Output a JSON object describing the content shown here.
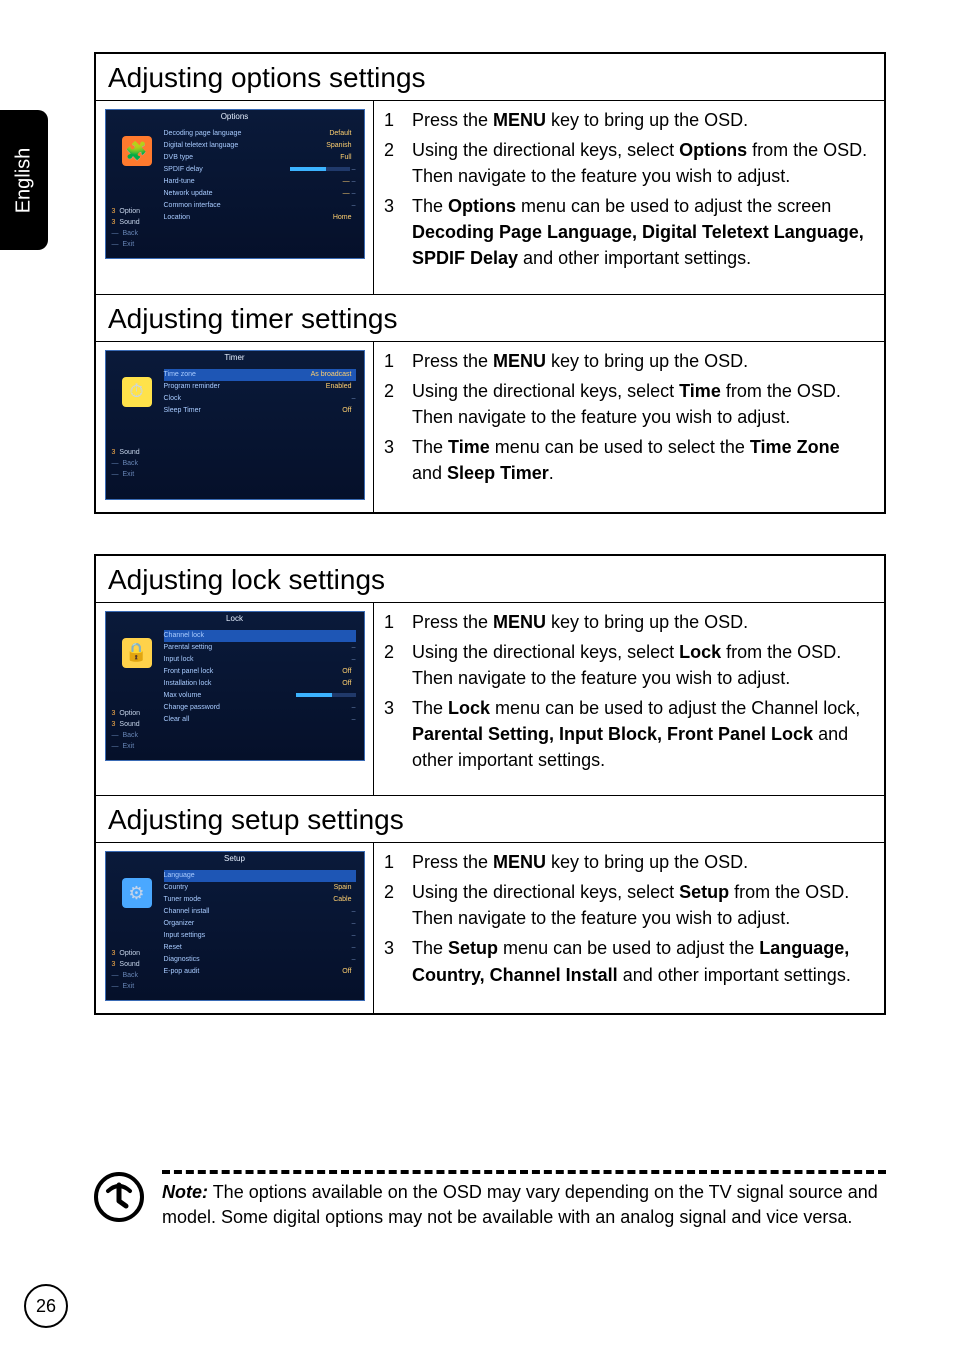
{
  "side_tab": {
    "label": "English"
  },
  "page_number": "26",
  "boxes": [
    {
      "sections": [
        {
          "title": "Adjusting options settings",
          "thumb": {
            "title_text": "Options",
            "icon_bg": "#ff7a2e",
            "icon_glyph": "🧩",
            "rows": [
              {
                "label": "Decoding page language",
                "value": "Default",
                "arrow": true
              },
              {
                "label": "Digital teletext language",
                "value": "Spanish",
                "arrow": true
              },
              {
                "label": "DVB type",
                "value": "Full",
                "arrow": true
              },
              {
                "label": "SPDIF delay",
                "value_bar": true,
                "dash": true
              },
              {
                "label": "Hard-tune",
                "value": "—",
                "dash": true
              },
              {
                "label": "Network update",
                "value": "—",
                "dash": true
              },
              {
                "label": "Common interface",
                "value": "",
                "dash": true
              },
              {
                "label": "Location",
                "value": "Home",
                "arrow": true
              }
            ],
            "left_menu": [
              {
                "num": "3",
                "label": "Option"
              },
              {
                "num": "3",
                "label": "Sound"
              },
              {
                "num": "—",
                "label": "Back",
                "dim": true
              },
              {
                "num": "—",
                "label": "Exit",
                "dim": true
              }
            ]
          },
          "steps": [
            {
              "num": "1",
              "parts": [
                "Press the ",
                {
                  "b": "MENU"
                },
                " key to bring up the OSD."
              ]
            },
            {
              "num": "2",
              "parts": [
                "Using the directional keys, select ",
                {
                  "b": "Options"
                },
                " from the OSD. Then navigate to the feature you wish to adjust."
              ]
            },
            {
              "num": "3",
              "parts": [
                "The ",
                {
                  "b": "Options"
                },
                " menu can be used to adjust the screen ",
                {
                  "b": "Decoding Page Language, Digital Teletext Language, SPDIF Delay"
                },
                " and other important settings."
              ]
            }
          ]
        },
        {
          "title": "Adjusting timer settings",
          "thumb": {
            "title_text": "Timer",
            "icon_bg": "#ffe24a",
            "icon_glyph": "⏱",
            "rows": [
              {
                "label": "Time zone",
                "value": "As broadcast",
                "arrow": true,
                "highlight": true
              },
              {
                "label": "Program reminder",
                "value": "Enabled",
                "arrow": true
              },
              {
                "label": "Clock",
                "value": "",
                "dash": true
              },
              {
                "label": "Sleep Timer",
                "value": "Off",
                "arrow": true
              }
            ],
            "left_menu": [
              {
                "num": "3",
                "label": "Sound"
              },
              {
                "num": "—",
                "label": "Back",
                "dim": true
              },
              {
                "num": "—",
                "label": "Exit",
                "dim": true
              }
            ]
          },
          "steps": [
            {
              "num": "1",
              "parts": [
                "Press the ",
                {
                  "b": "MENU"
                },
                " key to bring up the OSD."
              ]
            },
            {
              "num": "2",
              "parts": [
                "Using the directional keys, select ",
                {
                  "b": "Time"
                },
                " from the OSD. Then navigate to the feature you wish to adjust."
              ]
            },
            {
              "num": "3",
              "parts": [
                "The ",
                {
                  "b": "Time"
                },
                " menu can be used to select the ",
                {
                  "b": "Time Zone"
                },
                " and ",
                {
                  "b": "Sleep Timer"
                },
                "."
              ]
            }
          ]
        }
      ]
    },
    {
      "sections": [
        {
          "title": "Adjusting lock settings",
          "thumb": {
            "title_text": "Lock",
            "icon_bg": "#ffd24a",
            "icon_glyph": "🔒",
            "rows": [
              {
                "label": "Channel lock",
                "value": "",
                "highlight": true
              },
              {
                "label": "Parental setting",
                "value": "",
                "dash": true
              },
              {
                "label": "Input lock",
                "value": "",
                "dash": true
              },
              {
                "label": "Front panel lock",
                "value": "Off",
                "arrow": true
              },
              {
                "label": "Installation lock",
                "value": "Off",
                "arrow": true
              },
              {
                "label": "Max volume",
                "value_bar": true
              },
              {
                "label": "Change password",
                "value": "",
                "dash": true
              },
              {
                "label": "Clear all",
                "value": "",
                "dash": true
              }
            ],
            "left_menu": [
              {
                "num": "3",
                "label": "Option"
              },
              {
                "num": "3",
                "label": "Sound"
              },
              {
                "num": "—",
                "label": "Back",
                "dim": true
              },
              {
                "num": "—",
                "label": "Exit",
                "dim": true
              }
            ]
          },
          "steps": [
            {
              "num": "1",
              "parts": [
                "Press the ",
                {
                  "b": "MENU"
                },
                " key to bring up the OSD."
              ]
            },
            {
              "num": "2",
              "parts": [
                "Using the directional keys, select ",
                {
                  "b": "Lock"
                },
                " from the OSD. Then navigate to the feature you wish to adjust."
              ]
            },
            {
              "num": "3",
              "parts": [
                "The ",
                {
                  "b": "Lock"
                },
                " menu can be used to adjust the Channel lock, ",
                {
                  "b": "Parental Setting, Input Block, Front Panel Lock"
                },
                " and other important settings."
              ]
            }
          ]
        },
        {
          "title": "Adjusting setup settings",
          "thumb": {
            "title_text": "Setup",
            "icon_bg": "#4aa8ff",
            "icon_glyph": "⚙",
            "rows": [
              {
                "label": "Language",
                "value": "",
                "highlight": true
              },
              {
                "label": "Country",
                "value": "Spain",
                "arrow": true
              },
              {
                "label": "Tuner mode",
                "value": "Cable",
                "arrow": true
              },
              {
                "label": "Channel install",
                "value": "",
                "dash": true
              },
              {
                "label": "Organizer",
                "value": "",
                "dash": true
              },
              {
                "label": "Input settings",
                "value": "",
                "dash": true
              },
              {
                "label": "Reset",
                "value": "",
                "dash": true
              },
              {
                "label": "Diagnostics",
                "value": "",
                "dash": true
              },
              {
                "label": "E-pop audit",
                "value": "Off",
                "arrow": true
              }
            ],
            "left_menu": [
              {
                "num": "3",
                "label": "Option"
              },
              {
                "num": "3",
                "label": "Sound"
              },
              {
                "num": "—",
                "label": "Back",
                "dim": true
              },
              {
                "num": "—",
                "label": "Exit",
                "dim": true
              }
            ]
          },
          "steps": [
            {
              "num": "1",
              "parts": [
                "Press the ",
                {
                  "b": "MENU"
                },
                " key to bring up the OSD."
              ]
            },
            {
              "num": "2",
              "parts": [
                "Using the directional keys, select ",
                {
                  "b": "Setup"
                },
                " from the OSD. Then navigate to the feature you wish to adjust."
              ]
            },
            {
              "num": "3",
              "parts": [
                "The ",
                {
                  "b": "Setup"
                },
                " menu can be used to adjust the ",
                {
                  "b": "Language, Country, Channel Install"
                },
                " and other important settings."
              ]
            }
          ]
        }
      ]
    }
  ],
  "note": {
    "heading": "Note:",
    "text": "The options available on the OSD may vary depending on the TV signal source and model. Some digital options may not be available with an analog signal and vice versa."
  }
}
